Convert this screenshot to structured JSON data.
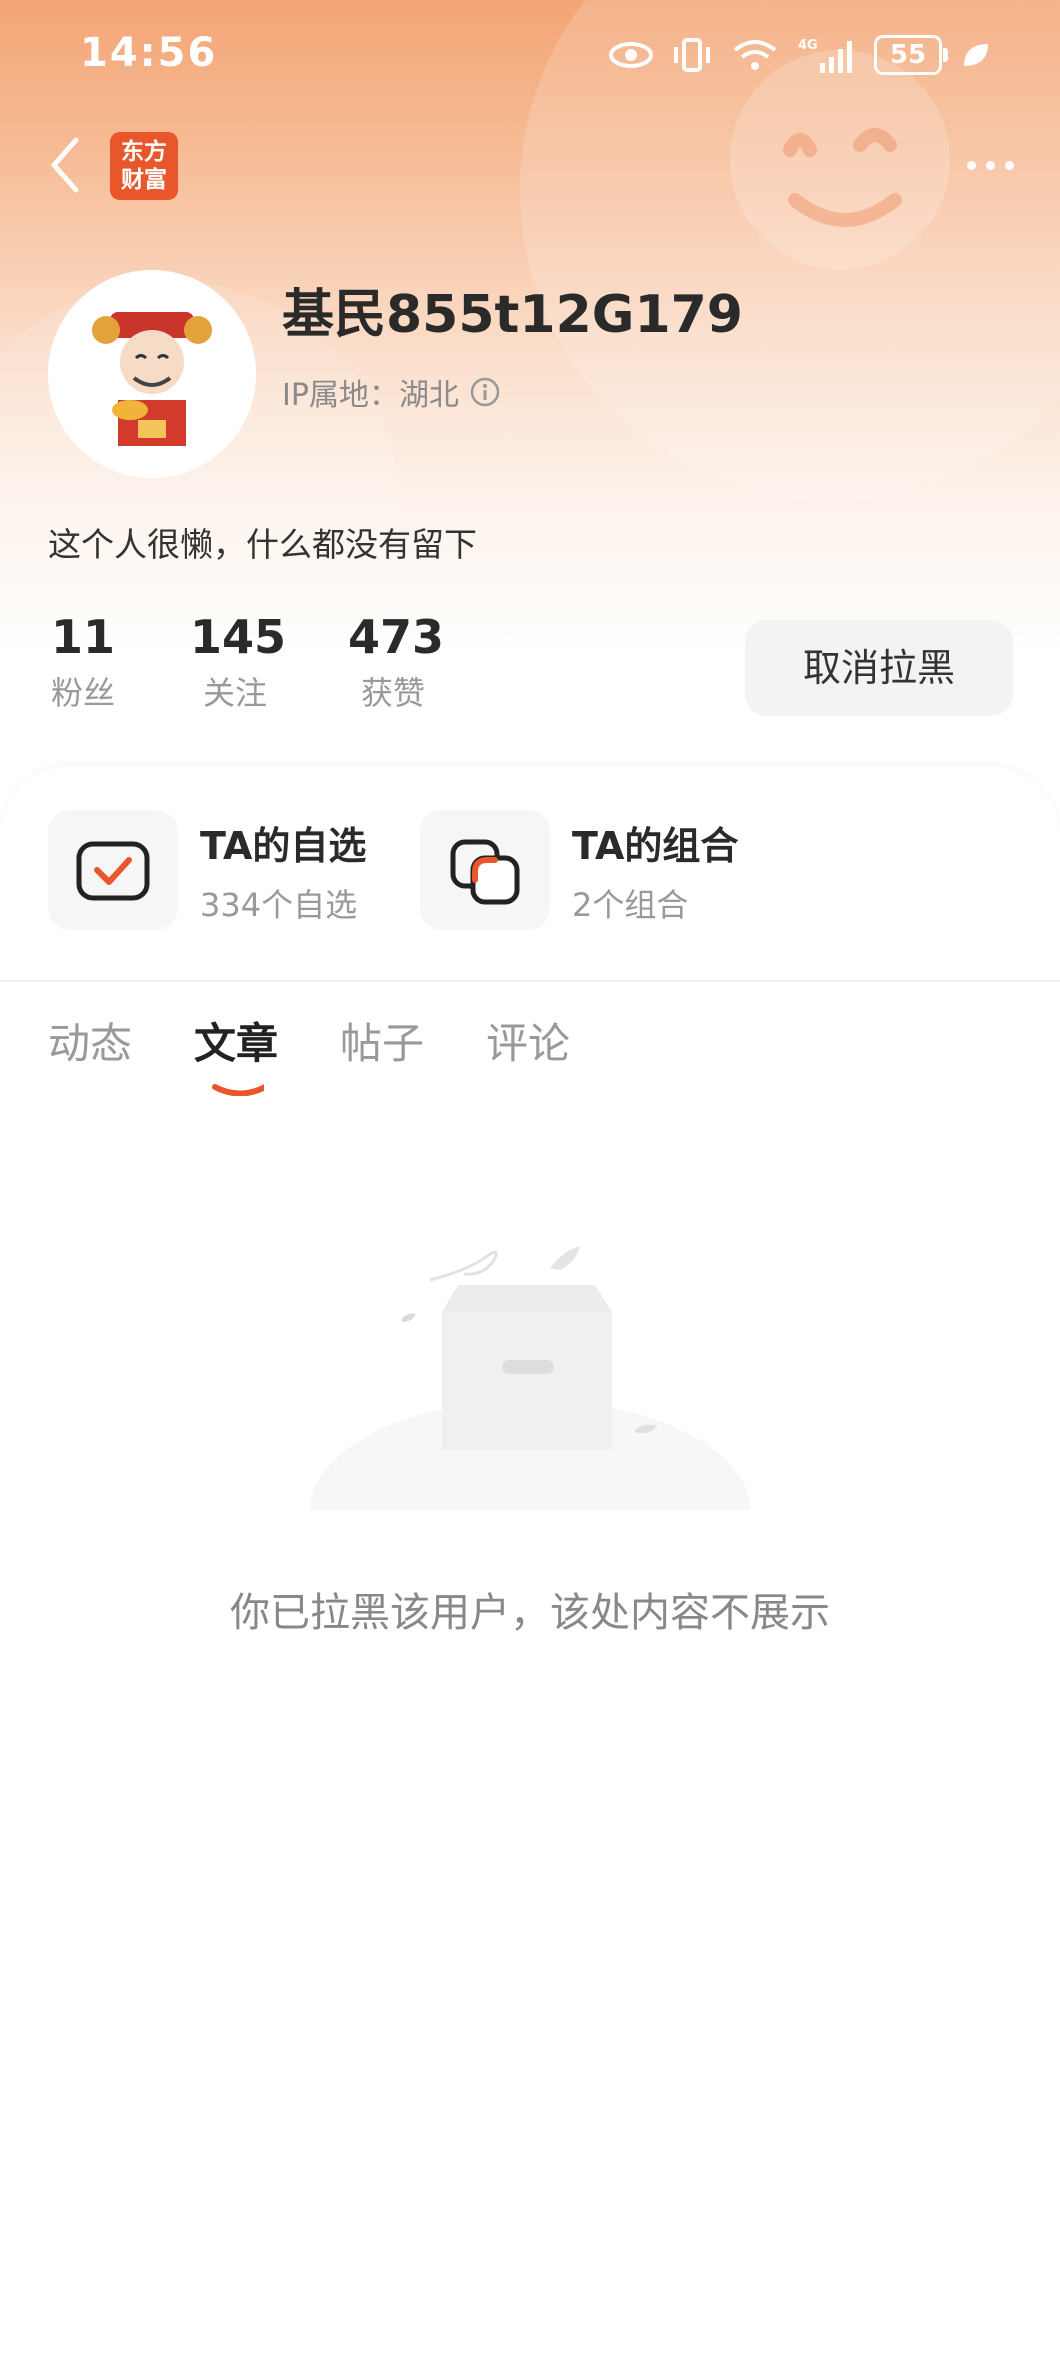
{
  "status_bar": {
    "time": "14:56",
    "battery": "55",
    "network": "4G"
  },
  "nav": {
    "logo_line1": "东方",
    "logo_line2": "财富"
  },
  "profile": {
    "username": "基民855t12G179",
    "ip_location": "IP属地：湖北",
    "bio": "这个人很懒，什么都没有留下",
    "stats": [
      {
        "value": "11",
        "label": "粉丝"
      },
      {
        "value": "145",
        "label": "关注"
      },
      {
        "value": "473",
        "label": "获赞"
      }
    ],
    "unblock_label": "取消拉黑"
  },
  "shortcuts": {
    "watchlist": {
      "title": "TA的自选",
      "subtitle": "334个自选"
    },
    "portfolio": {
      "title": "TA的组合",
      "subtitle": "2个组合"
    }
  },
  "tabs": [
    "动态",
    "文章",
    "帖子",
    "评论"
  ],
  "active_tab": "文章",
  "empty_message": "你已拉黑该用户，该处内容不展示",
  "colors": {
    "accent": "#e8562a",
    "header_top": "#f3a574"
  }
}
